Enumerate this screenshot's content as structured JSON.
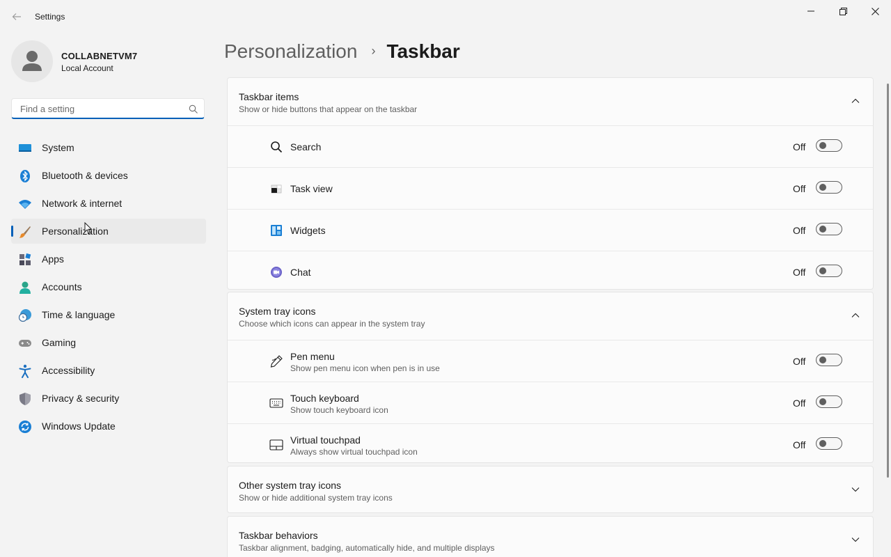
{
  "window": {
    "title": "Settings",
    "back_icon": "back-arrow-icon",
    "controls": [
      "minimize-icon",
      "restore-icon",
      "close-icon"
    ]
  },
  "account": {
    "name": "COLLABNETVM7",
    "type": "Local Account"
  },
  "search": {
    "placeholder": "Find a setting",
    "value": ""
  },
  "sidebar": {
    "items": [
      {
        "label": "System",
        "icon": "system-monitor-icon"
      },
      {
        "label": "Bluetooth & devices",
        "icon": "bluetooth-icon"
      },
      {
        "label": "Network & internet",
        "icon": "wifi-icon"
      },
      {
        "label": "Personalization",
        "icon": "paintbrush-icon",
        "selected": true
      },
      {
        "label": "Apps",
        "icon": "apps-icon"
      },
      {
        "label": "Accounts",
        "icon": "accounts-icon"
      },
      {
        "label": "Time & language",
        "icon": "globe-clock-icon"
      },
      {
        "label": "Gaming",
        "icon": "gamepad-icon"
      },
      {
        "label": "Accessibility",
        "icon": "accessibility-icon"
      },
      {
        "label": "Privacy & security",
        "icon": "shield-icon"
      },
      {
        "label": "Windows Update",
        "icon": "update-icon"
      }
    ]
  },
  "header": {
    "parent": "Personalization",
    "separator": "›",
    "current": "Taskbar"
  },
  "sections": {
    "taskbar_items": {
      "title": "Taskbar items",
      "subtitle": "Show or hide buttons that appear on the taskbar",
      "expanded": true,
      "rows": [
        {
          "label": "Search",
          "state": "Off",
          "icon": "search-icon"
        },
        {
          "label": "Task view",
          "state": "Off",
          "icon": "task-view-icon"
        },
        {
          "label": "Widgets",
          "state": "Off",
          "icon": "widgets-icon"
        },
        {
          "label": "Chat",
          "state": "Off",
          "icon": "chat-icon"
        }
      ]
    },
    "system_tray": {
      "title": "System tray icons",
      "subtitle": "Choose which icons can appear in the system tray",
      "expanded": true,
      "rows": [
        {
          "label": "Pen menu",
          "sub": "Show pen menu icon when pen is in use",
          "state": "Off",
          "icon": "pen-icon"
        },
        {
          "label": "Touch keyboard",
          "sub": "Show touch keyboard icon",
          "state": "Off",
          "icon": "keyboard-icon"
        },
        {
          "label": "Virtual touchpad",
          "sub": "Always show virtual touchpad icon",
          "state": "Off",
          "icon": "touchpad-icon"
        }
      ]
    },
    "other_tray": {
      "title": "Other system tray icons",
      "subtitle": "Show or hide additional system tray icons",
      "expanded": false
    },
    "behaviors": {
      "title": "Taskbar behaviors",
      "subtitle": "Taskbar alignment, badging, automatically hide, and multiple displays",
      "expanded": false
    }
  },
  "colors": {
    "accent": "#005fb8",
    "background": "#f3f3f3",
    "card": "#fbfbfb"
  }
}
